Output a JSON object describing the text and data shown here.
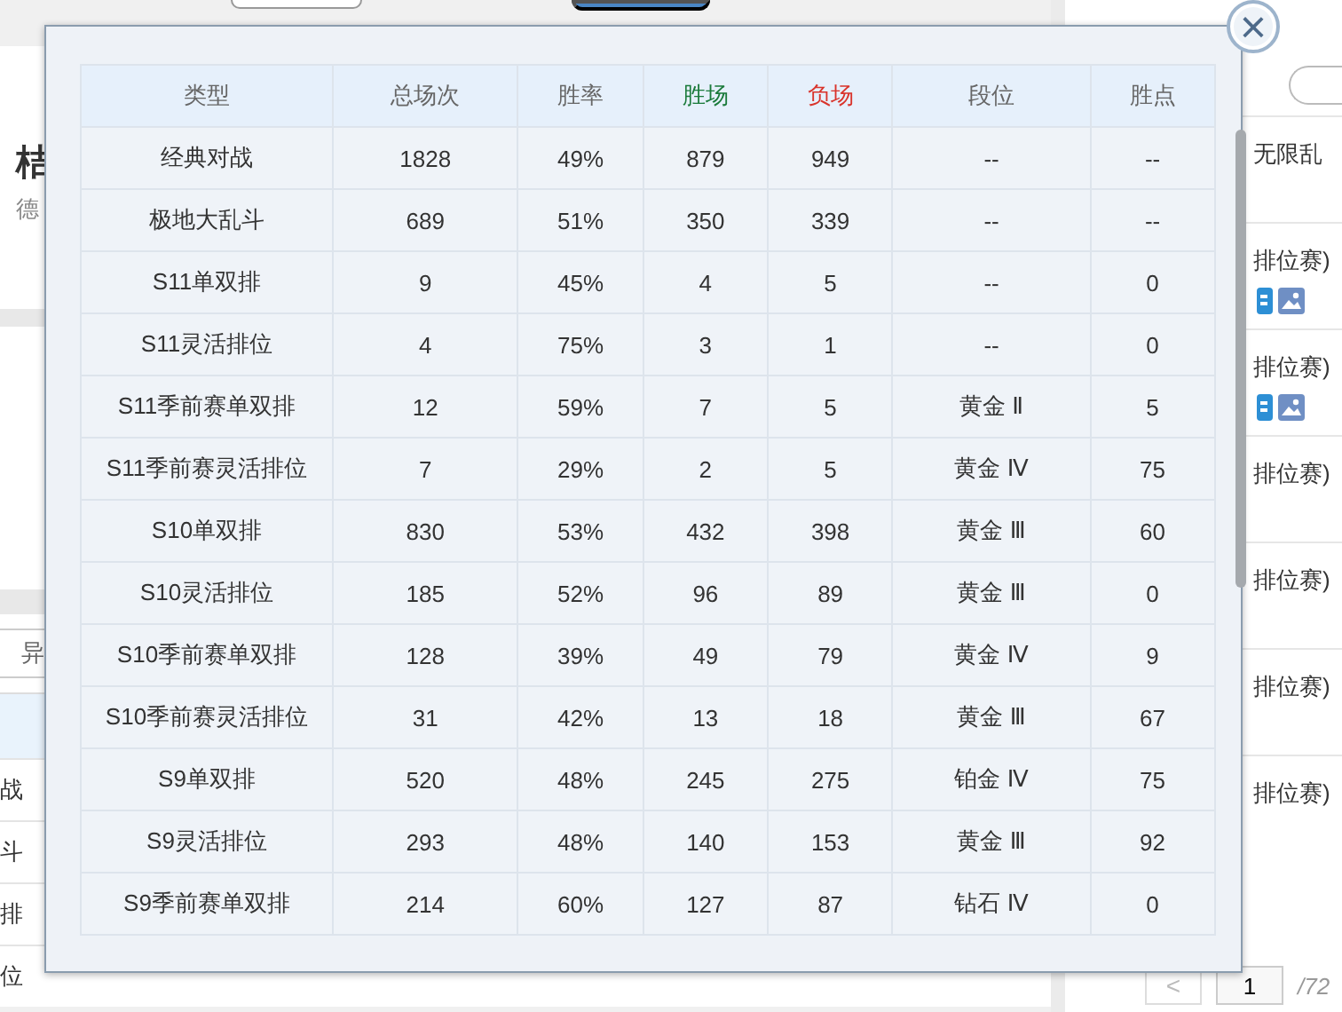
{
  "profile": {
    "name": "桔",
    "subtitle": "德"
  },
  "search": {
    "value": "异"
  },
  "history_table": {
    "rows": [
      {
        "cells": [
          "战"
        ]
      },
      {
        "cells": [
          "斗"
        ]
      },
      {
        "cells": [
          "排"
        ]
      },
      {
        "cells": [
          "位"
        ]
      }
    ]
  },
  "match_list": [
    {
      "title": "无限乱",
      "has_icons": false
    },
    {
      "title": "排位赛)",
      "has_icons": true
    },
    {
      "title": "排位赛)",
      "has_icons": true
    },
    {
      "title": "排位赛)",
      "has_icons": false
    },
    {
      "title": "排位赛)",
      "has_icons": false
    },
    {
      "title": "排位赛)",
      "has_icons": false
    },
    {
      "title": "排位赛)",
      "has_icons": false
    }
  ],
  "pager": {
    "prev": "<",
    "page": "1",
    "total": "/72"
  },
  "modal": {
    "close": "×",
    "columns": [
      {
        "label": "类型",
        "color": "#666666"
      },
      {
        "label": "总场次",
        "color": "#666666"
      },
      {
        "label": "胜率",
        "color": "#666666"
      },
      {
        "label": "胜场",
        "color": "#1a7a3a"
      },
      {
        "label": "负场",
        "color": "#d9342b"
      },
      {
        "label": "段位",
        "color": "#666666"
      },
      {
        "label": "胜点",
        "color": "#666666"
      }
    ],
    "rows": [
      [
        "经典对战",
        "1828",
        "49%",
        "879",
        "949",
        "--",
        "--"
      ],
      [
        "极地大乱斗",
        "689",
        "51%",
        "350",
        "339",
        "--",
        "--"
      ],
      [
        "S11单双排",
        "9",
        "45%",
        "4",
        "5",
        "--",
        "0"
      ],
      [
        "S11灵活排位",
        "4",
        "75%",
        "3",
        "1",
        "--",
        "0"
      ],
      [
        "S11季前赛单双排",
        "12",
        "59%",
        "7",
        "5",
        "黄金 Ⅱ",
        "5"
      ],
      [
        "S11季前赛灵活排位",
        "7",
        "29%",
        "2",
        "5",
        "黄金 Ⅳ",
        "75"
      ],
      [
        "S10单双排",
        "830",
        "53%",
        "432",
        "398",
        "黄金 Ⅲ",
        "60"
      ],
      [
        "S10灵活排位",
        "185",
        "52%",
        "96",
        "89",
        "黄金 Ⅲ",
        "0"
      ],
      [
        "S10季前赛单双排",
        "128",
        "39%",
        "49",
        "79",
        "黄金 Ⅳ",
        "9"
      ],
      [
        "S10季前赛灵活排位",
        "31",
        "42%",
        "13",
        "18",
        "黄金 Ⅲ",
        "67"
      ],
      [
        "S9单双排",
        "520",
        "48%",
        "245",
        "275",
        "铂金 Ⅳ",
        "75"
      ],
      [
        "S9灵活排位",
        "293",
        "48%",
        "140",
        "153",
        "黄金 Ⅲ",
        "92"
      ],
      [
        "S9季前赛单双排",
        "214",
        "60%",
        "127",
        "87",
        "钻石 Ⅳ",
        "0"
      ]
    ]
  }
}
